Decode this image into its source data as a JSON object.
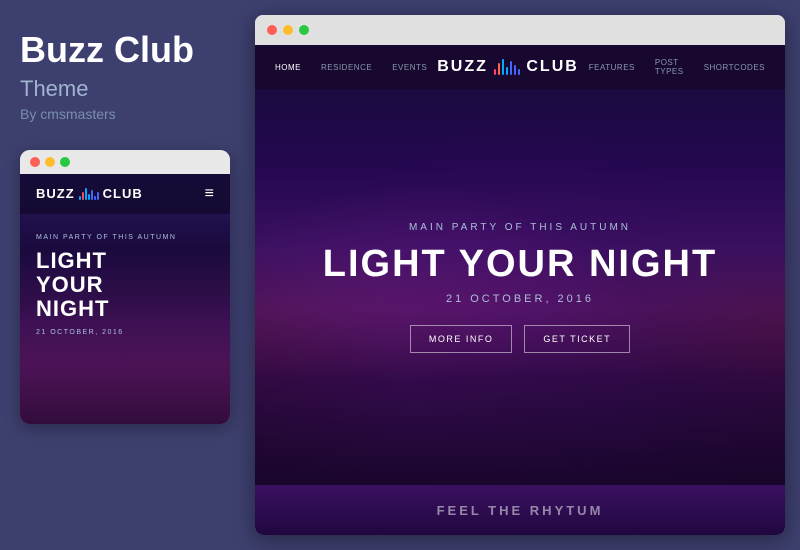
{
  "sidebar": {
    "title": "Buzz Club",
    "subtitle": "Theme",
    "by": "By cmsmasters",
    "mobile": {
      "titlebar_dots": [
        "red",
        "yellow",
        "green"
      ],
      "logo": {
        "buzz": "BUZZ",
        "club": "CLUB"
      },
      "hamburger": "≡",
      "hero": {
        "subtitle": "MAIN PARTY OF THIS AUTUMN",
        "title_line1": "LIGHT",
        "title_line2": "YOUR",
        "title_line3": "NIGHT",
        "date": "21 OCTOBER, 2016"
      }
    }
  },
  "desktop": {
    "titlebar_dots": [
      "red",
      "yellow",
      "green"
    ],
    "nav": {
      "links": [
        "HOME",
        "RESIDENCE",
        "EVENTS",
        "FEATURES",
        "POST TYPES",
        "SHORTCODES"
      ],
      "active": "HOME",
      "logo": {
        "buzz": "BUZZ",
        "club": "CLUB"
      }
    },
    "hero": {
      "subtitle": "MAIN PARTY OF THIS AUTUMN",
      "title": "LIGHT YOUR NIGHT",
      "date": "21 OCTOBER, 2016",
      "btn1": "MORE INFO",
      "btn2": "GET TICKET"
    },
    "bottom": {
      "text": "FEEL THE RHYTUM"
    }
  },
  "colors": {
    "accent_blue": "#00aaff",
    "accent_red": "#ff4466",
    "bar_colors": [
      "#ff4466",
      "#ff6644",
      "#ffaa00",
      "#00aaff",
      "#0088ff",
      "#0066ff",
      "#4444ff",
      "#6644ff"
    ]
  }
}
